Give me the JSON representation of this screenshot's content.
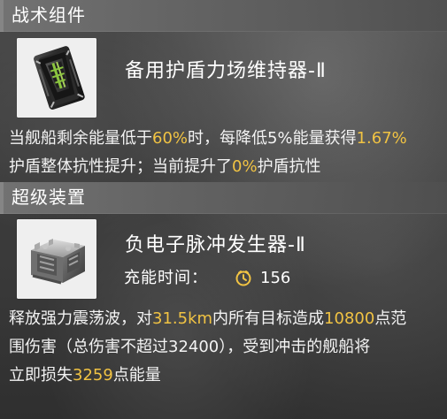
{
  "sections": [
    {
      "title": "战术组件",
      "module_name": "备用护盾力场维持器-Ⅱ",
      "icon_name": "shield-generator-icon",
      "description_lines": [
        [
          {
            "text": "当舰船剩余能量低于",
            "hl": false
          },
          {
            "text": "60%",
            "hl": true
          },
          {
            "text": "时，每降低5%能量获得",
            "hl": false
          },
          {
            "text": "1.67%",
            "hl": true
          }
        ],
        [
          {
            "text": "护盾整体抗性提升；当前提升了",
            "hl": false
          },
          {
            "text": "0%",
            "hl": true
          },
          {
            "text": "护盾抗性",
            "hl": false
          }
        ]
      ]
    },
    {
      "title": "超级装置",
      "module_name": "负电子脉冲发生器-Ⅱ",
      "icon_name": "pulse-generator-icon",
      "charge_label": "充能时间：",
      "charge_icon": "charge-time-icon",
      "charge_value": "156",
      "description_lines": [
        [
          {
            "text": "释放强力震荡波，对",
            "hl": false
          },
          {
            "text": "31.5km",
            "hl": true
          },
          {
            "text": "内所有目标造成",
            "hl": false
          },
          {
            "text": "10800",
            "hl": true
          },
          {
            "text": "点范",
            "hl": false
          }
        ],
        [
          {
            "text": "围伤害（总伤害不超过32400），受到冲击的舰船将",
            "hl": false
          }
        ],
        [
          {
            "text": "立即损失",
            "hl": false
          },
          {
            "text": "3259",
            "hl": true
          },
          {
            "text": "点能量",
            "hl": false
          }
        ]
      ]
    }
  ],
  "colors": {
    "highlight": "#f1c343",
    "text": "#f3f3f3",
    "header": "#6f6f6f"
  }
}
